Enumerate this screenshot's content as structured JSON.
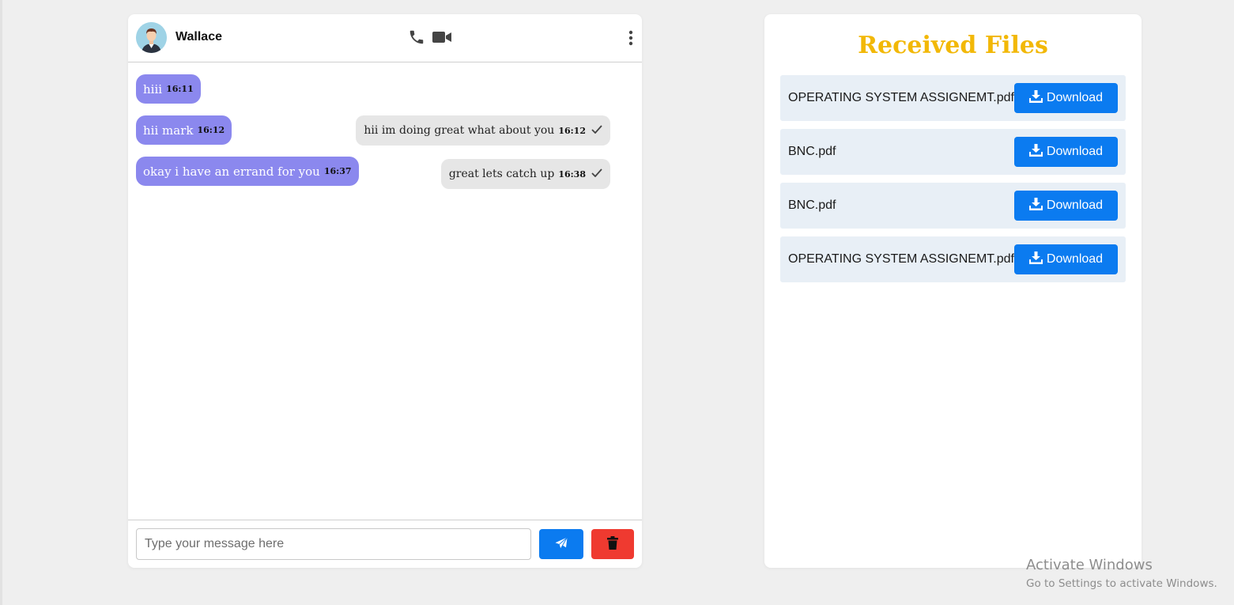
{
  "chat": {
    "contact_name": "Wallace",
    "messages": [
      {
        "direction": "in",
        "text": "hiii",
        "time": "16:11"
      },
      {
        "direction": "in",
        "text": "hii mark",
        "time": "16:12"
      },
      {
        "direction": "out",
        "text": "hii im doing great what about you",
        "time": "16:12",
        "status": "check-icon"
      },
      {
        "direction": "in",
        "text": "okay i have an errand for you",
        "time": "16:37"
      },
      {
        "direction": "out",
        "text": "great lets catch up",
        "time": "16:38",
        "status": "check-icon"
      }
    ],
    "input": {
      "placeholder": "Type your message here",
      "value": ""
    },
    "icons": {
      "call": "phone-icon",
      "video": "video-camera-icon",
      "menu": "vertical-dots-icon",
      "send": "paper-plane-icon",
      "delete": "trash-icon"
    },
    "colors": {
      "incoming_bubble": "#8b88ee",
      "outgoing_bubble": "#e6e6e6",
      "send": "#0b7bf0",
      "delete": "#ef3a30"
    }
  },
  "files": {
    "title": "Received Files",
    "title_color": "#f2b807",
    "download_label": "Download",
    "download_icon": "download-icon",
    "items": [
      {
        "name": "OPERATING SYSTEM ASSIGNEMT.pdf"
      },
      {
        "name": "BNC.pdf"
      },
      {
        "name": "BNC.pdf"
      },
      {
        "name": "OPERATING SYSTEM ASSIGNEMT.pdf"
      }
    ]
  },
  "watermark": {
    "title": "Activate Windows",
    "subtitle": "Go to Settings to activate Windows."
  }
}
